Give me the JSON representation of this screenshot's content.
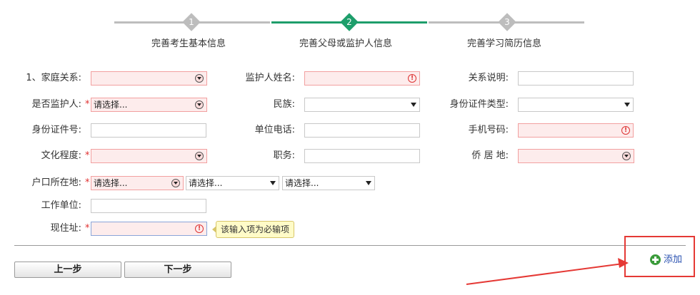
{
  "steps": [
    {
      "num": "1",
      "label": "完善考生基本信息",
      "state": "done"
    },
    {
      "num": "2",
      "label": "完善父母或监护人信息",
      "state": "active"
    },
    {
      "num": "3",
      "label": "完善学习简历信息",
      "state": "todo"
    }
  ],
  "colors": {
    "active": "#1e9e6b",
    "inactive": "#bdbdbd",
    "error_bg": "#fdecec",
    "annotation": "#e53935",
    "link": "#2850b0"
  },
  "form": {
    "relation": {
      "label": "1、家庭关系:",
      "value": ""
    },
    "guardian_name": {
      "label": "监护人姓名:",
      "value": ""
    },
    "relation_note": {
      "label": "关系说明:",
      "value": ""
    },
    "is_guardian": {
      "label": "是否监护人:",
      "value": "请选择..."
    },
    "ethnicity": {
      "label": "民族:",
      "value": ""
    },
    "id_type": {
      "label": "身份证件类型:",
      "value": ""
    },
    "id_number": {
      "label": "身份证件号:",
      "value": ""
    },
    "work_phone": {
      "label": "单位电话:",
      "value": ""
    },
    "mobile": {
      "label": "手机号码:",
      "value": ""
    },
    "education": {
      "label": "文化程度:",
      "value": ""
    },
    "position": {
      "label": "职务:",
      "value": ""
    },
    "residence_place": {
      "label": "侨 居 地:",
      "value": ""
    },
    "hukou": {
      "label": "户口所在地:",
      "selects": [
        "请选择...",
        "请选择...",
        "请选择..."
      ]
    },
    "workplace": {
      "label": "工作单位:",
      "value": ""
    },
    "address": {
      "label": "现住址:",
      "value": ""
    }
  },
  "required_mark": "*",
  "tooltip": "该输入项为必输项",
  "buttons": {
    "prev": "上一步",
    "next": "下一步"
  },
  "add_link": "添加",
  "icons": {
    "error": "!",
    "add": "plus-circle-icon"
  }
}
